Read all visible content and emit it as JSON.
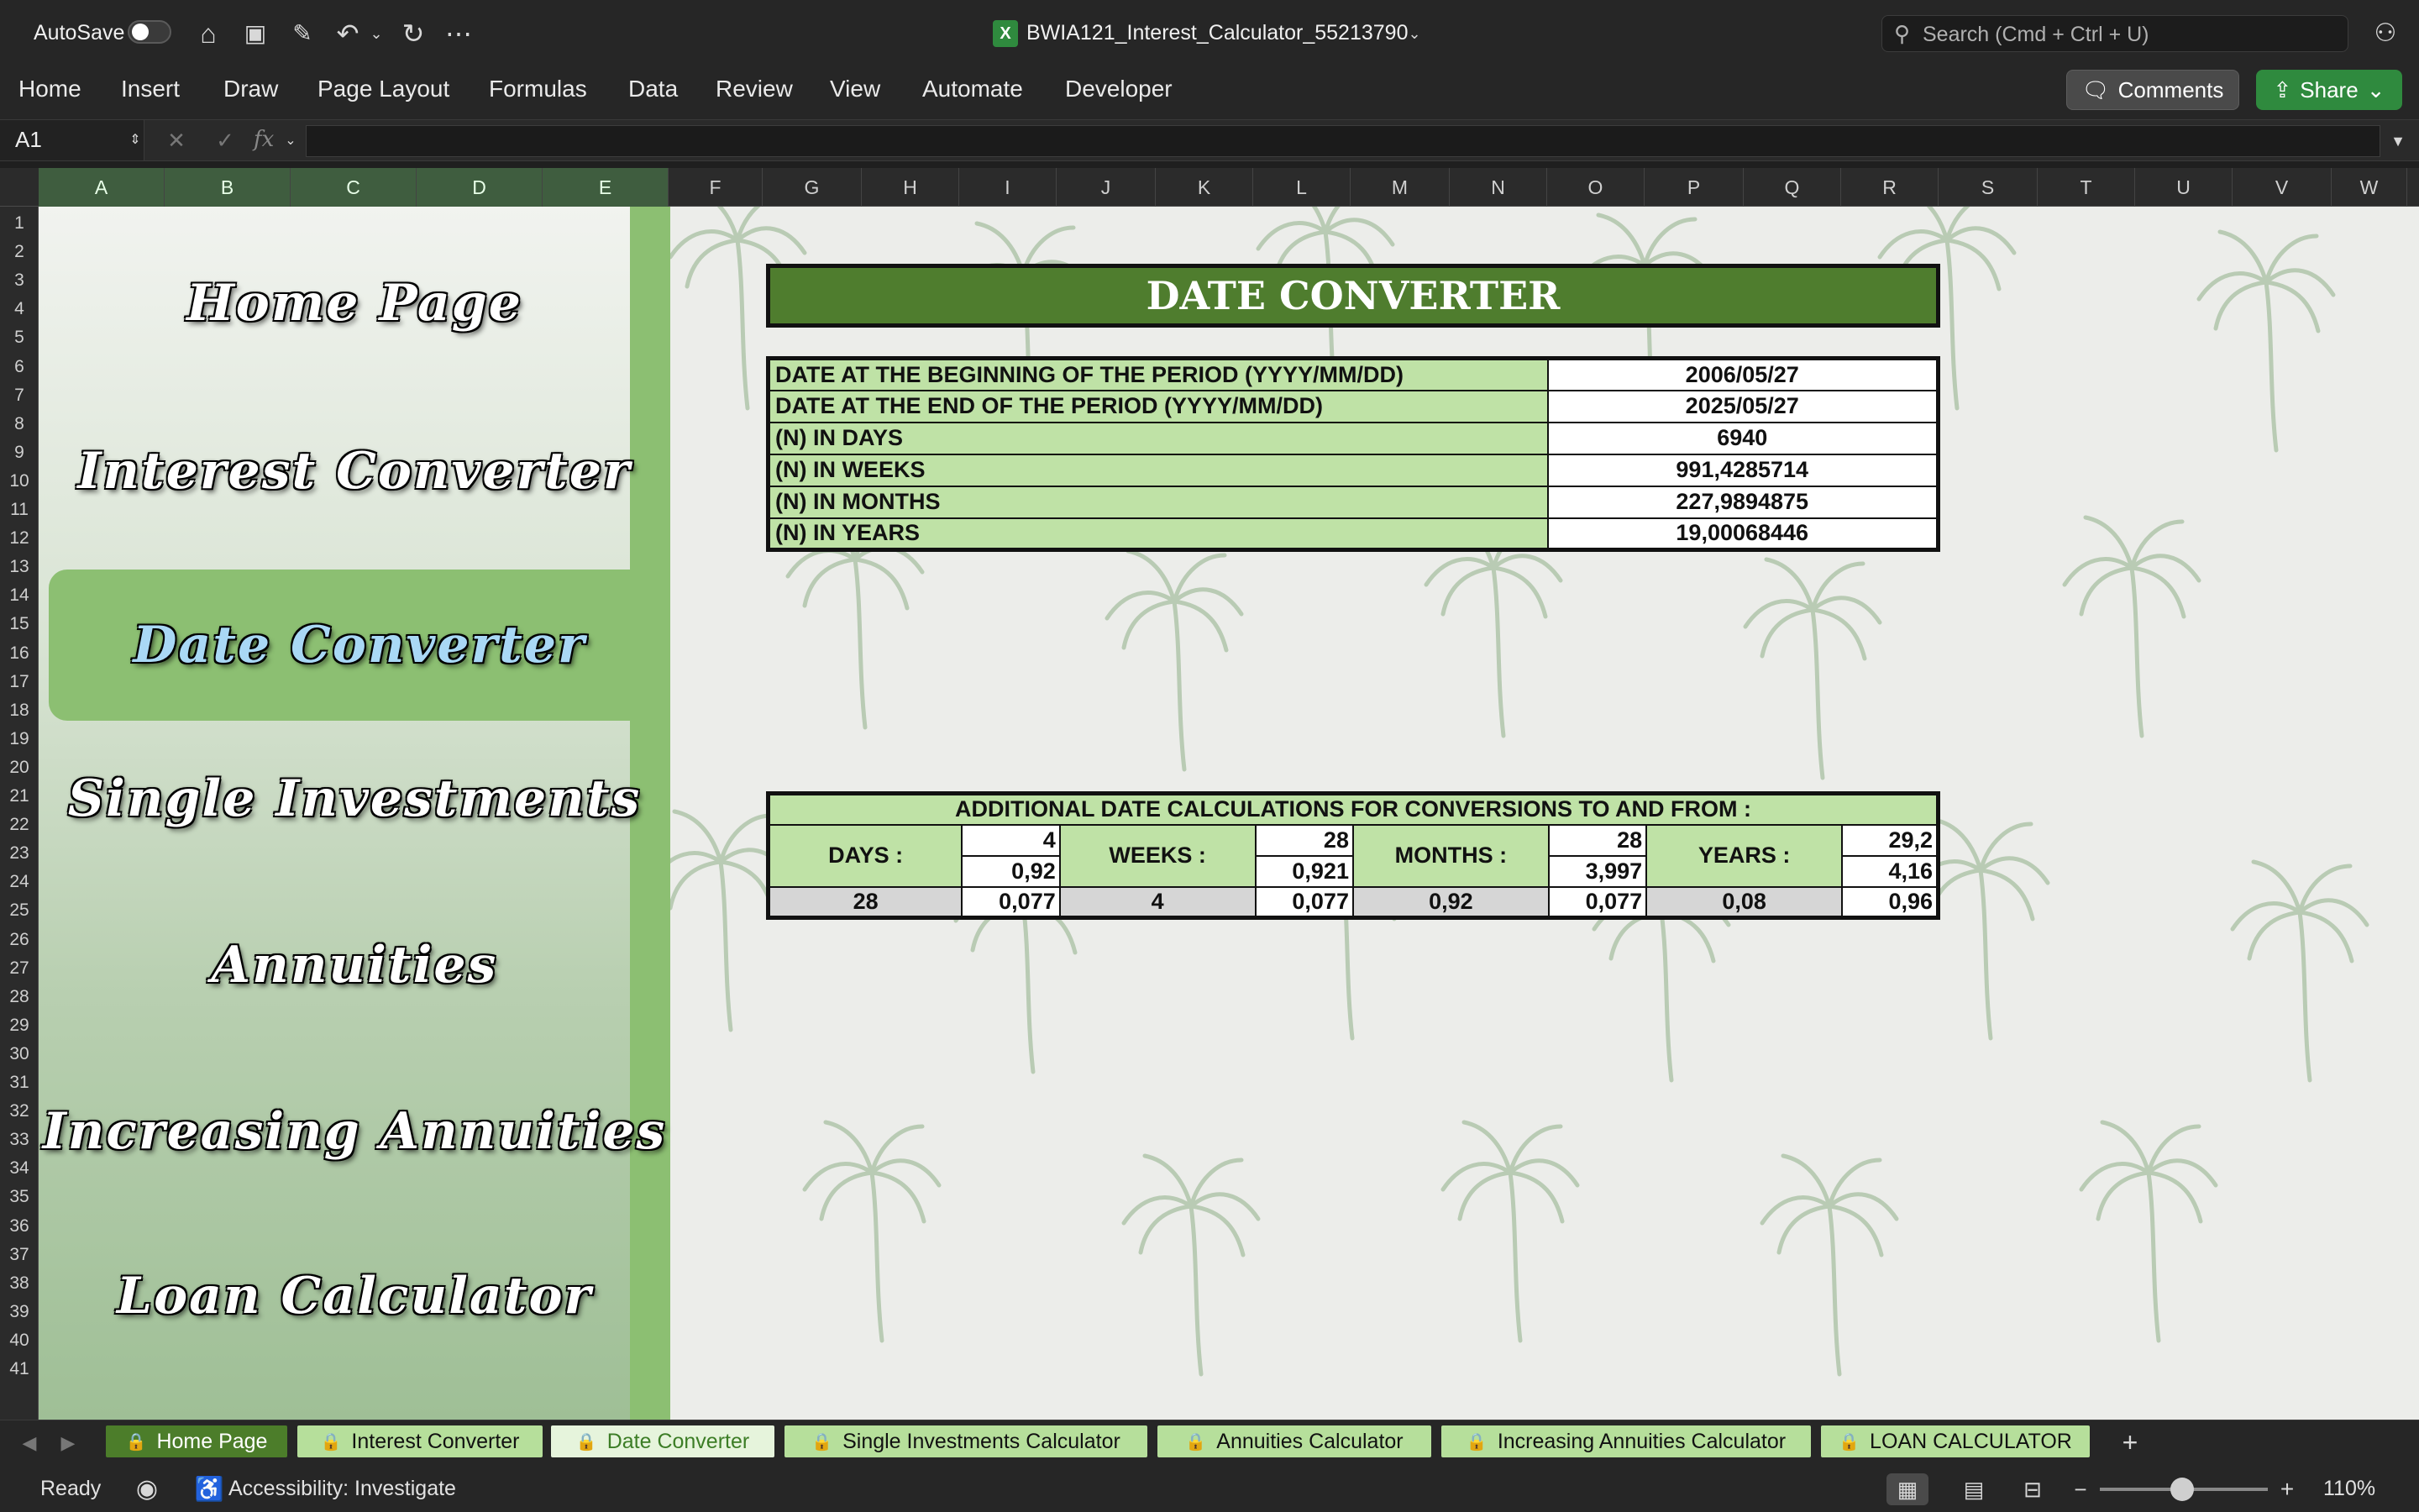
{
  "titlebar": {
    "autosave_label": "AutoSave",
    "file_name": "BWIA121_Interest_Calculator_55213790",
    "search_placeholder": "Search (Cmd + Ctrl + U)"
  },
  "ribbon": {
    "tabs": [
      "Home",
      "Insert",
      "Draw",
      "Page Layout",
      "Formulas",
      "Data",
      "Review",
      "View",
      "Automate",
      "Developer"
    ],
    "comments_label": "Comments",
    "share_label": "Share"
  },
  "formula_bar": {
    "cell_ref": "A1",
    "fx_label": "fx",
    "content": ""
  },
  "columns": [
    "A",
    "B",
    "C",
    "D",
    "E",
    "F",
    "G",
    "H",
    "I",
    "J",
    "K",
    "L",
    "M",
    "N",
    "O",
    "P",
    "Q",
    "R",
    "S",
    "T",
    "U",
    "V",
    "W"
  ],
  "rows": [
    "1",
    "2",
    "3",
    "4",
    "5",
    "6",
    "7",
    "8",
    "9",
    "10",
    "11",
    "12",
    "13",
    "14",
    "15",
    "16",
    "17",
    "18",
    "19",
    "20",
    "21",
    "22",
    "23",
    "24",
    "25",
    "26",
    "27",
    "28",
    "29",
    "30",
    "31",
    "32",
    "33",
    "34",
    "35",
    "36",
    "37",
    "38",
    "39",
    "40",
    "41"
  ],
  "nav": {
    "items": [
      "Home Page",
      "Interest Converter",
      "Date Converter",
      "Single Investments",
      "Annuities",
      "Increasing Annuities",
      "Loan Calculator"
    ],
    "active": "Date Converter"
  },
  "date_converter": {
    "title": "DATE CONVERTER",
    "rows": [
      {
        "label": "DATE AT THE BEGINNING OF THE PERIOD (YYYY/MM/DD)",
        "value": "2006/05/27"
      },
      {
        "label": "DATE AT THE END OF THE PERIOD (YYYY/MM/DD)",
        "value": "2025/05/27"
      },
      {
        "label": "(N) IN DAYS",
        "value": "6940"
      },
      {
        "label": "(N) IN WEEKS",
        "value": "991,4285714"
      },
      {
        "label": "(N) IN MONTHS",
        "value": "227,9894875"
      },
      {
        "label": "(N) IN YEARS",
        "value": "19,00068446"
      }
    ],
    "additional": {
      "header": "ADDITIONAL DATE CALCULATIONS FOR CONVERSIONS TO AND FROM :",
      "days_label": "DAYS :",
      "weeks_label": "WEEKS :",
      "months_label": "MONTHS :",
      "years_label": "YEARS :",
      "days_top": "4",
      "days_mid": "0,92",
      "weeks_top": "28",
      "weeks_mid": "0,921",
      "months_top": "28",
      "months_mid": "3,997",
      "years_top": "29,2",
      "years_mid": "4,16",
      "bottom": [
        "28",
        "0,077",
        "4",
        "0,077",
        "0,92",
        "0,077",
        "0,08",
        "0,96"
      ]
    }
  },
  "sheet_tabs": [
    "Home Page",
    "Interest Converter",
    "Date Converter",
    "Single Investments Calculator",
    "Annuities Calculator",
    "Increasing Annuities Calculator",
    "LOAN CALCULATOR"
  ],
  "status": {
    "ready": "Ready",
    "accessibility": "Accessibility: Investigate",
    "zoom": "110%"
  }
}
